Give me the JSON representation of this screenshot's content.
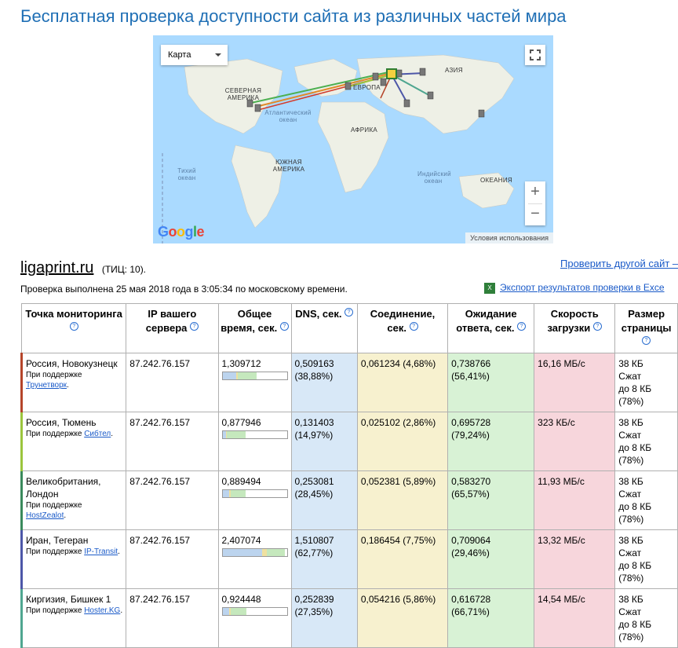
{
  "page": {
    "title": "Бесплатная проверка доступности сайта из различных частей мира"
  },
  "map": {
    "type_select": "Карта",
    "labels": {
      "north_america": "СЕВЕРНАЯ АМЕРИКА",
      "europe": "ЕВРОПА",
      "asia": "АЗИЯ",
      "africa": "АФРИКА",
      "south_america": "ЮЖНАЯ АМЕРИКА",
      "oceania": "ОКЕАНИЯ",
      "atlantic": "Атлантический океан",
      "pacific": "Тихий океан",
      "indian": "Индийский океан"
    },
    "google_logo": "Google",
    "terms": "Условия использования",
    "zoom_in": "+",
    "zoom_out": "−"
  },
  "site": {
    "domain": "ligaprint.ru",
    "tic": "(ТИЦ: 10)."
  },
  "links": {
    "check_other": "Проверить другой сайт –",
    "export": "Экспорт результатов проверки в Exce"
  },
  "status": {
    "done": "Проверка выполнена 25 мая 2018 года в 3:05:34 по московскому времени."
  },
  "table": {
    "headers": [
      "Точка мониторинга",
      "IP вашего сервера",
      "Общее время, сек.",
      "DNS, сек.",
      "Соединение, сек.",
      "Ожидание ответа, сек.",
      "Скорость загрузки",
      "Размер страницы"
    ],
    "sponsor_prefix": "При поддержке",
    "rows": [
      {
        "location": "Россия, Новокузнецк",
        "sponsor": "Трунетворк",
        "color": "#b5452a",
        "ip": "87.242.76.157",
        "total": "1,309712",
        "total_value": 1.309712,
        "dns": "0,509163",
        "dns_pct": "(38,88%)",
        "conn": "0,061234 (4,68%)",
        "wait": "0,738766",
        "wait_pct": "(56,41%)",
        "speed": "16,16 МБ/с",
        "size": [
          "38 КБ",
          "Сжат",
          "до 8 КБ",
          "(78%)"
        ]
      },
      {
        "location": "Россия, Тюмень",
        "sponsor": "Сибтел",
        "color": "#9bc53d",
        "ip": "87.242.76.157",
        "total": "0,877946",
        "total_value": 0.877946,
        "dns": "0,131403",
        "dns_pct": "(14,97%)",
        "conn": "0,025102 (2,86%)",
        "wait": "0,695728",
        "wait_pct": "(79,24%)",
        "speed": "323 КБ/с",
        "size": [
          "38 КБ",
          "Сжат",
          "до 8 КБ",
          "(78%)"
        ]
      },
      {
        "location": "Великобритания, Лондон",
        "sponsor": "HostZealot",
        "color": "#3a8a5c",
        "ip": "87.242.76.157",
        "total": "0,889494",
        "total_value": 0.889494,
        "dns": "0,253081",
        "dns_pct": "(28,45%)",
        "conn": "0,052381 (5,89%)",
        "wait": "0,583270",
        "wait_pct": "(65,57%)",
        "speed": "11,93 МБ/с",
        "size": [
          "38 КБ",
          "Сжат",
          "до 8 КБ",
          "(78%)"
        ]
      },
      {
        "location": "Иран, Тегеран",
        "sponsor": "IP-Transit",
        "color": "#4d57a8",
        "ip": "87.242.76.157",
        "total": "2,407074",
        "total_value": 2.407074,
        "dns": "1,510807",
        "dns_pct": "(62,77%)",
        "conn": "0,186454 (7,75%)",
        "wait": "0,709064",
        "wait_pct": "(29,46%)",
        "speed": "13,32 МБ/с",
        "size": [
          "38 КБ",
          "Сжат",
          "до 8 КБ",
          "(78%)"
        ]
      },
      {
        "location": "Киргизия, Бишкек 1",
        "sponsor": "Hoster.KG",
        "color": "#4fa690",
        "ip": "87.242.76.157",
        "total": "0,924448",
        "total_value": 0.924448,
        "dns": "0,252839",
        "dns_pct": "(27,35%)",
        "conn": "0,054216 (5,86%)",
        "wait": "0,616728",
        "wait_pct": "(66,71%)",
        "speed": "14,54 МБ/с",
        "size": [
          "38 КБ",
          "Сжат",
          "до 8 КБ",
          "(78%)"
        ]
      }
    ]
  }
}
